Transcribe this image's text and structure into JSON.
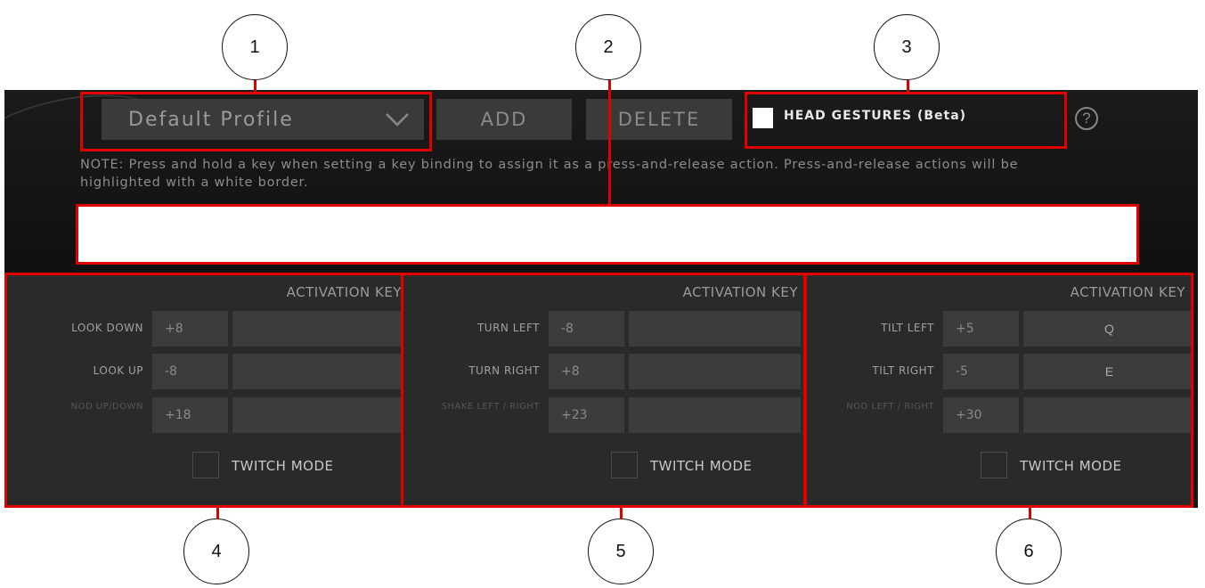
{
  "callouts": [
    "1",
    "2",
    "3",
    "4",
    "5",
    "6"
  ],
  "toolbar": {
    "profile_selected": "Default Profile",
    "add_label": "ADD",
    "delete_label": "DELETE",
    "head_gestures_label": "HEAD GESTURES (Beta)",
    "head_gestures_checked": false,
    "help_label": "?"
  },
  "note": "NOTE: Press and hold a key when setting a key binding to assign it as a press-and-release action. Press-and-release actions will be highlighted with a white border.",
  "panels": [
    {
      "activation_key_label": "ACTIVATION KEY",
      "rows": [
        {
          "label": "LOOK DOWN",
          "value": "+8",
          "key": ""
        },
        {
          "label": "LOOK UP",
          "value": "-8",
          "key": ""
        },
        {
          "label": "NOD UP/DOWN",
          "value": "+18",
          "key": ""
        }
      ],
      "twitch_label": "TWITCH MODE",
      "twitch_checked": false
    },
    {
      "activation_key_label": "ACTIVATION KEY",
      "rows": [
        {
          "label": "TURN LEFT",
          "value": "-8",
          "key": ""
        },
        {
          "label": "TURN RIGHT",
          "value": "+8",
          "key": ""
        },
        {
          "label": "SHAKE LEFT / RIGHT",
          "value": "+23",
          "key": ""
        }
      ],
      "twitch_label": "TWITCH MODE",
      "twitch_checked": false
    },
    {
      "activation_key_label": "ACTIVATION KEY",
      "rows": [
        {
          "label": "TILT LEFT",
          "value": "+5",
          "key": "Q"
        },
        {
          "label": "TILT RIGHT",
          "value": "-5",
          "key": "E"
        },
        {
          "label": "NOD LEFT / RIGHT",
          "value": "+30",
          "key": ""
        }
      ],
      "twitch_label": "TWITCH MODE",
      "twitch_checked": false
    }
  ]
}
